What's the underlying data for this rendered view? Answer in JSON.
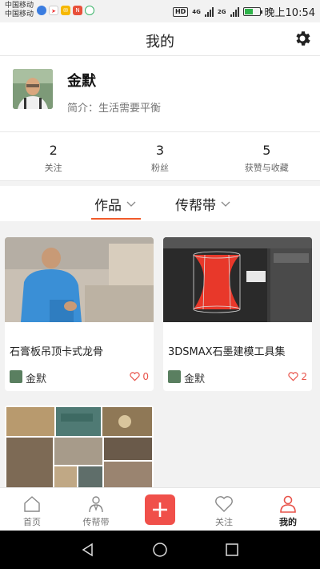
{
  "status_bar": {
    "carrier_1": "中国移动",
    "carrier_2": "中国移动",
    "network": "4G",
    "network_2": "2G",
    "hd": "HD",
    "time": "晚上10:54"
  },
  "header": {
    "title": "我的"
  },
  "profile": {
    "name": "金默",
    "bio": "简介：生活需要平衡"
  },
  "stats": [
    {
      "value": "2",
      "label": "关注"
    },
    {
      "value": "3",
      "label": "粉丝"
    },
    {
      "value": "5",
      "label": "获赞与收藏"
    }
  ],
  "tabs": [
    {
      "label": "作品",
      "active": true
    },
    {
      "label": "传帮带",
      "active": false
    }
  ],
  "cards": [
    {
      "title": "石膏板吊顶卡式龙骨",
      "author": "金默",
      "likes": "0"
    },
    {
      "title": "3DSMAX石墨建模工具集",
      "author": "金默",
      "likes": "2"
    }
  ],
  "bottom_nav": [
    {
      "label": "首页",
      "icon": "home-icon"
    },
    {
      "label": "传帮带",
      "icon": "person-icon"
    },
    {
      "label": "",
      "icon": "plus-icon"
    },
    {
      "label": "关注",
      "icon": "heart-icon"
    },
    {
      "label": "我的",
      "icon": "user-icon"
    }
  ],
  "colors": {
    "accent": "#f05a2a",
    "add_button": "#f0504a",
    "like": "#e8534a"
  }
}
